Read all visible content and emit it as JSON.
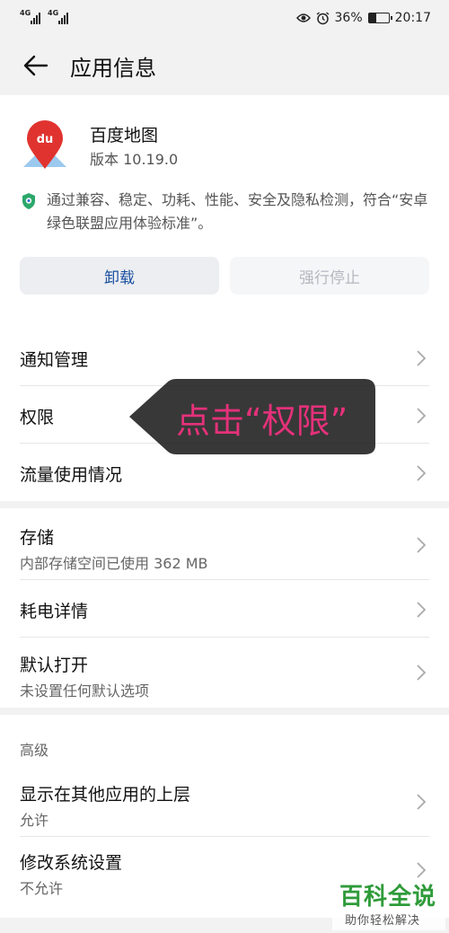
{
  "status_bar": {
    "signal_1": "4G",
    "signal_2": "4G",
    "battery": "36%",
    "battery_level": 0.36,
    "time": "20:17",
    "icons": [
      "eye-icon",
      "alarm-icon"
    ]
  },
  "header": {
    "title": "应用信息"
  },
  "app": {
    "name": "百度地图",
    "version": "版本 10.19.0",
    "green_notice": "通过兼容、稳定、功耗、性能、安全及隐私检测，符合“安卓绿色联盟应用体验标准”。",
    "uninstall_label": "卸载",
    "force_stop_label": "强行停止",
    "colors": {
      "uninstall_text": "#1a4fa0",
      "icon_red": "#e0332f"
    }
  },
  "section_main": {
    "items": [
      {
        "title": "通知管理"
      },
      {
        "title": "权限"
      },
      {
        "title": "流量使用情况"
      }
    ]
  },
  "section_storage": {
    "items": [
      {
        "title": "存储",
        "subtitle": "内部存储空间已使用 362 MB"
      },
      {
        "title": "耗电详情"
      },
      {
        "title": "默认打开",
        "subtitle": "未设置任何默认选项"
      }
    ]
  },
  "section_advanced": {
    "label": "高级",
    "items": [
      {
        "title": "显示在其他应用的上层",
        "subtitle": "允许"
      },
      {
        "title": "修改系统设置",
        "subtitle": "不允许"
      }
    ]
  },
  "callout": {
    "text": "点击“权限”",
    "color": "#e4317a"
  },
  "watermark": {
    "main": "百科全说",
    "sub": "助你轻松解决"
  }
}
